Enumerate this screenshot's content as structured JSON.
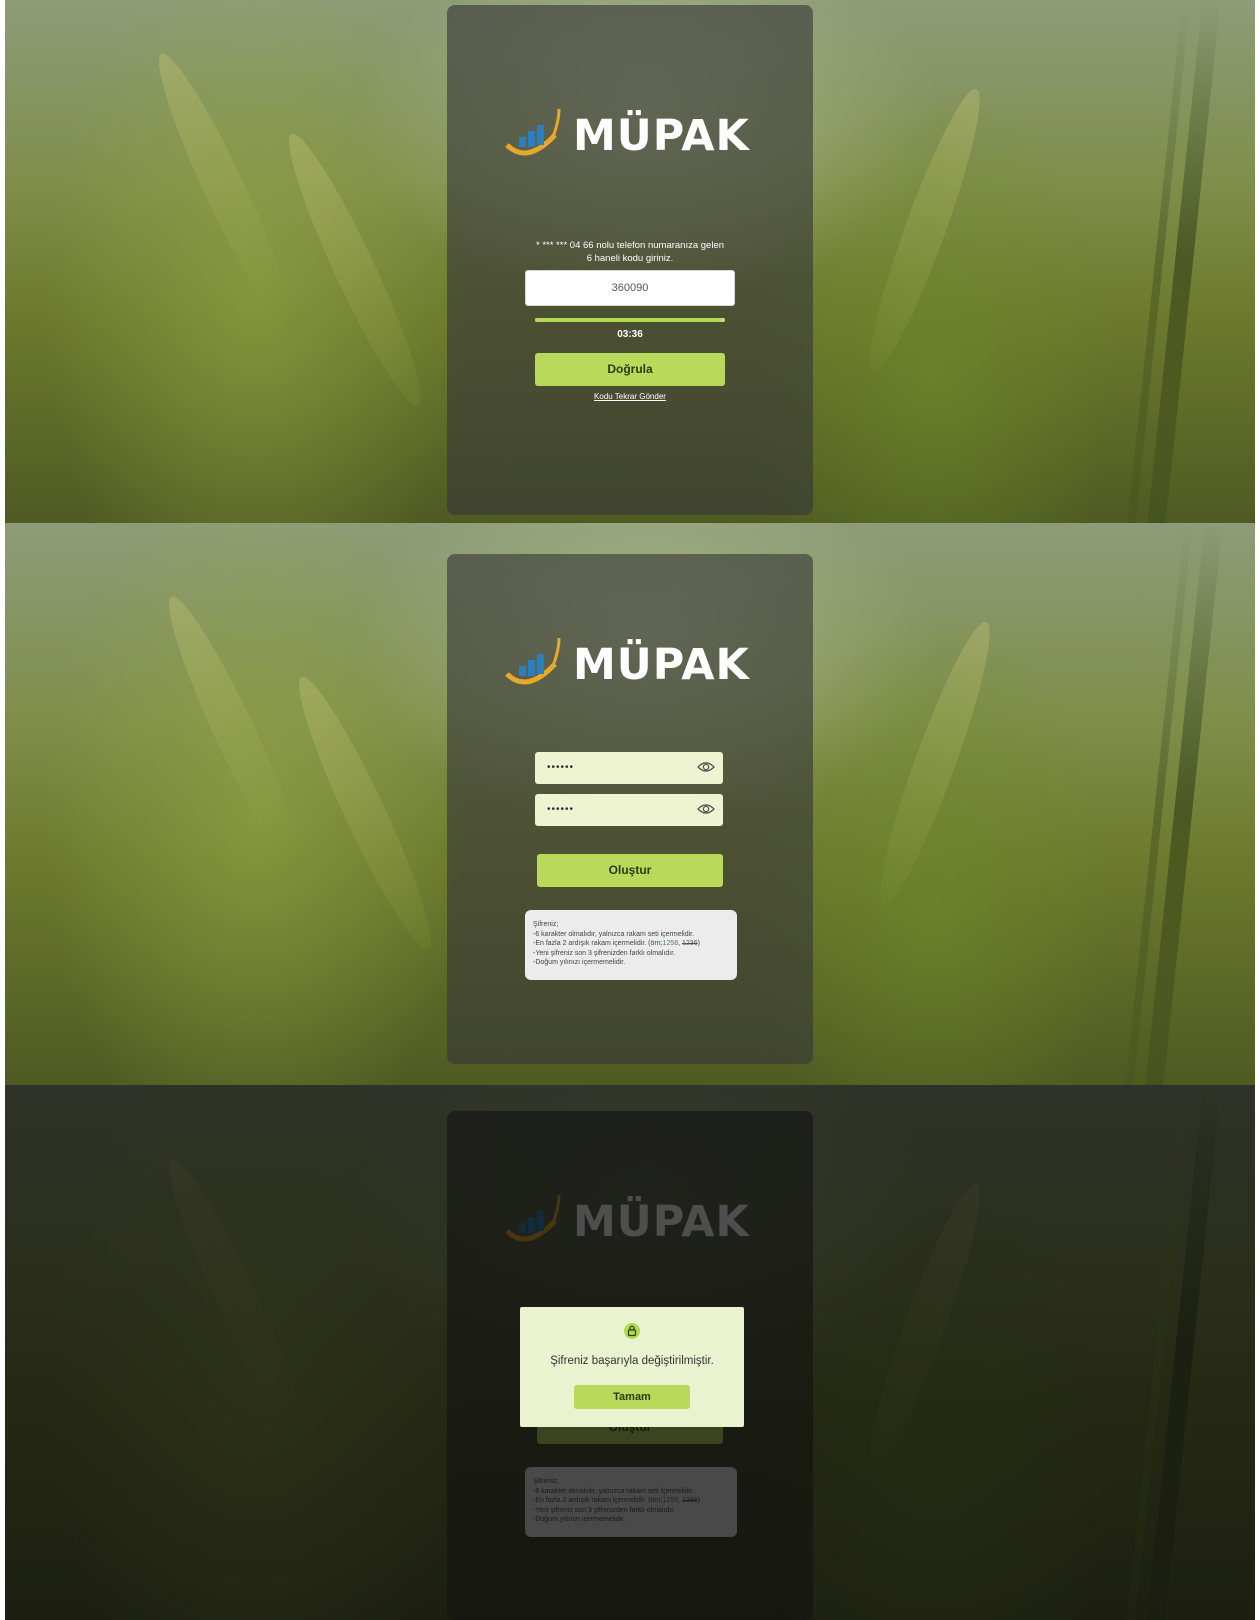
{
  "brand": {
    "name": "MÜPAK"
  },
  "verify_screen": {
    "prompt_line1": "* *** *** 04 66 nolu telefon numaranıza gelen",
    "prompt_line2": "6 haneli kodu giriniz.",
    "code_value": "360090",
    "progress_fraction": 0.98,
    "timer": "03:36",
    "verify_label": "Doğrula",
    "resend_label": "Kodu Tekrar Gönder"
  },
  "password_screen": {
    "new_password_value": "••••••",
    "confirm_password_value": "••••••",
    "create_label": "Oluştur",
    "rules": {
      "title": "Şifreniz;",
      "rule1": "-6 karakter olmalıdır, yalnızca rakam seti içermelidir.",
      "rule2_prefix": "-En fazla 2 ardışık rakam içermelidir. (örn;",
      "rule2_good": "1258",
      "rule2_sep": ", ",
      "rule2_bad": "1236",
      "rule2_suffix": ")",
      "rule3": "-Yeni şifreniz son 3 şifrenizden farklı olmalıdır.",
      "rule4": "-Doğum yılınızı içermemelidir."
    }
  },
  "success_dialog": {
    "icon": "lock-icon",
    "message": "Şifreniz başarıyla değiştirilmiştir.",
    "ok_label": "Tamam"
  },
  "colors": {
    "accent": "#b8d95a",
    "card": "#373737",
    "field_bg": "#eef4d2",
    "logo_blue": "#2a7fc1",
    "logo_gold": "#e8a82a"
  }
}
